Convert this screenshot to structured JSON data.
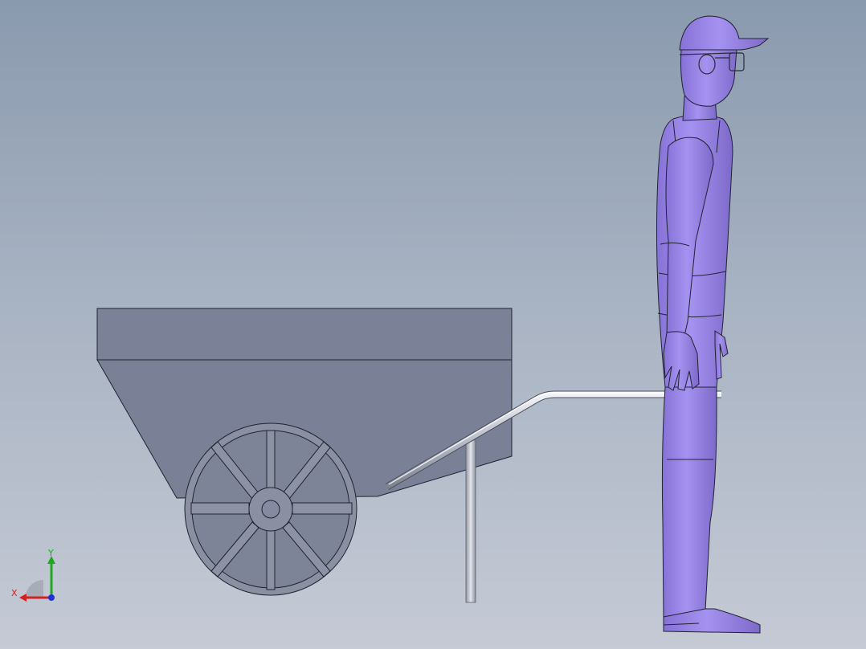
{
  "viewport": {
    "background_top": "#8a9aae",
    "background_bottom": "#c5cad5"
  },
  "model": {
    "parts": [
      "wheelbarrow-tray",
      "wheelbarrow-wheel",
      "handle-bar",
      "support-leg",
      "human-figure"
    ],
    "colors": {
      "tray": "#7b8196",
      "wheel": "#8a8fa2",
      "metal": "#c9ccd6",
      "figure": "#9a86e6",
      "edge": "#1f2330"
    }
  },
  "triad": {
    "x_label": "X",
    "y_label": "Y",
    "x_color": "#d42020",
    "y_color": "#1fa81f",
    "z_color": "#2030d8"
  }
}
